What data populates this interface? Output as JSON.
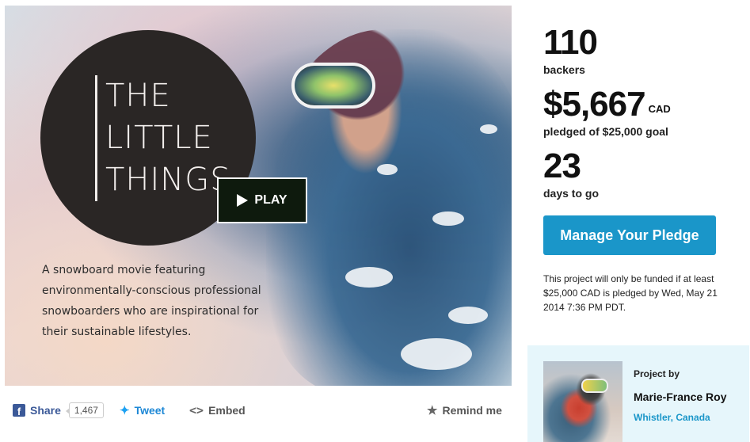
{
  "hero": {
    "title_lines": [
      "THE",
      "LITTLE",
      "THINGS"
    ],
    "play_label": "PLAY",
    "blurb": "A snowboard movie featuring environmentally-conscious professional snowboarders who are inspirational for their sustainable lifestyles."
  },
  "share_bar": {
    "share_label": "Share",
    "share_count": "1,467",
    "tweet_label": "Tweet",
    "embed_label": "Embed",
    "remind_label": "Remind me"
  },
  "stats": {
    "backers_value": "110",
    "backers_label": "backers",
    "pledged_value": "$5,667",
    "pledged_currency": "CAD",
    "pledged_label": "pledged of $25,000 goal",
    "days_value": "23",
    "days_label": "days to go"
  },
  "pledge_button_label": "Manage Your Pledge",
  "funding_note": "This project will only be funded if at least $25,000 CAD is pledged by Wed, May 21 2014 7:36 PM PDT.",
  "creator": {
    "heading": "Project by",
    "name": "Marie-France Roy",
    "location": "Whistler, Canada"
  },
  "colors": {
    "accent": "#1a96c9",
    "facebook": "#3b5998",
    "twitter": "#1da1f2",
    "creator_panel_bg": "#e6f6fb"
  },
  "icons": [
    "play-icon",
    "facebook-icon",
    "twitter-icon",
    "embed-icon",
    "star-icon"
  ]
}
